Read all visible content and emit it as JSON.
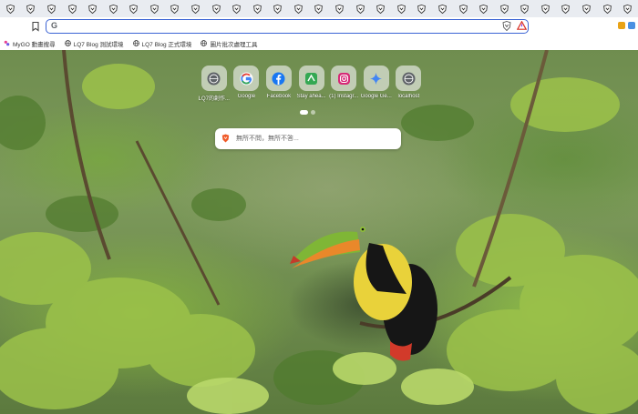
{
  "tabs": {
    "count": 31,
    "favicon": "shield-icon"
  },
  "toolbar": {
    "omnibox_prefix": "G",
    "omnibox_value": ""
  },
  "bookmarks": [
    {
      "label": "MyGO 動畫搜尋",
      "icon": "mygo-icon"
    },
    {
      "label": "LQ7 Blog 測試環境",
      "icon": "globe-icon"
    },
    {
      "label": "LQ7 Blog 正式環境",
      "icon": "globe-icon"
    },
    {
      "label": "圖片批次處理工具",
      "icon": "globe-icon"
    }
  ],
  "shortcuts": [
    {
      "label": "LQ7的創作...",
      "icon": "globe-icon",
      "color": "#5f6368"
    },
    {
      "label": "Google",
      "icon": "google-icon",
      "color": "#ffffff"
    },
    {
      "label": "Facebook",
      "icon": "facebook-icon",
      "color": "#1877f2"
    },
    {
      "label": "Stay ahea...",
      "icon": "stay-icon",
      "color": "#34a853"
    },
    {
      "label": "(1) Instagr...",
      "icon": "instagram-icon",
      "color": "#d62976"
    },
    {
      "label": "Google Ge...",
      "icon": "gemini-icon",
      "color": "#4285f4"
    },
    {
      "label": "localhost",
      "icon": "globe-icon",
      "color": "#5f6368"
    }
  ],
  "carousel": {
    "pages": 2,
    "active": 1
  },
  "ntp_search": {
    "placeholder": "無所不問，無所不答..."
  },
  "colors": {
    "omnibox_border": "#3b63d4",
    "brave_orange": "#f05a28",
    "warning_red": "#d93025"
  }
}
